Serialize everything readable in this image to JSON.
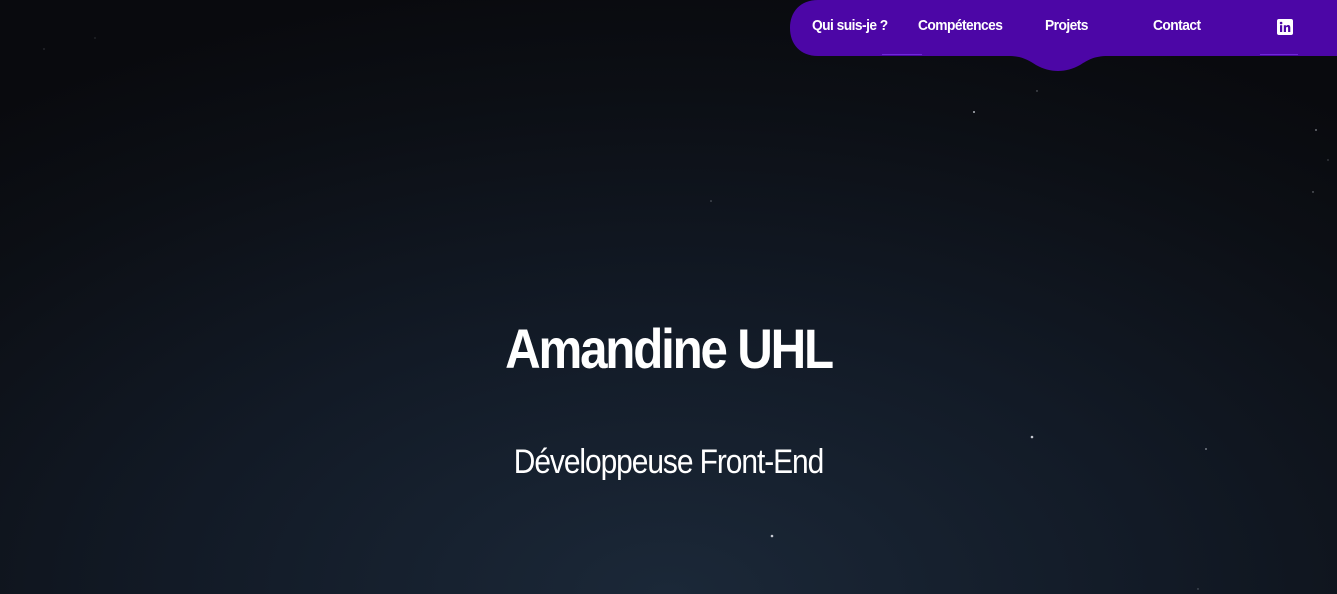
{
  "nav": {
    "items": [
      {
        "label": "Qui suis-je ?"
      },
      {
        "label": "Compétences"
      },
      {
        "label": "Projets"
      },
      {
        "label": "Contact"
      }
    ],
    "social_icon": "linkedin-icon",
    "background_color": "#4c06a6"
  },
  "hero": {
    "title": "Amandine UHL",
    "subtitle": "Développeuse Front-End"
  },
  "colors": {
    "accent": "#4c06a6",
    "background": "#121a26",
    "text": "#ffffff"
  }
}
